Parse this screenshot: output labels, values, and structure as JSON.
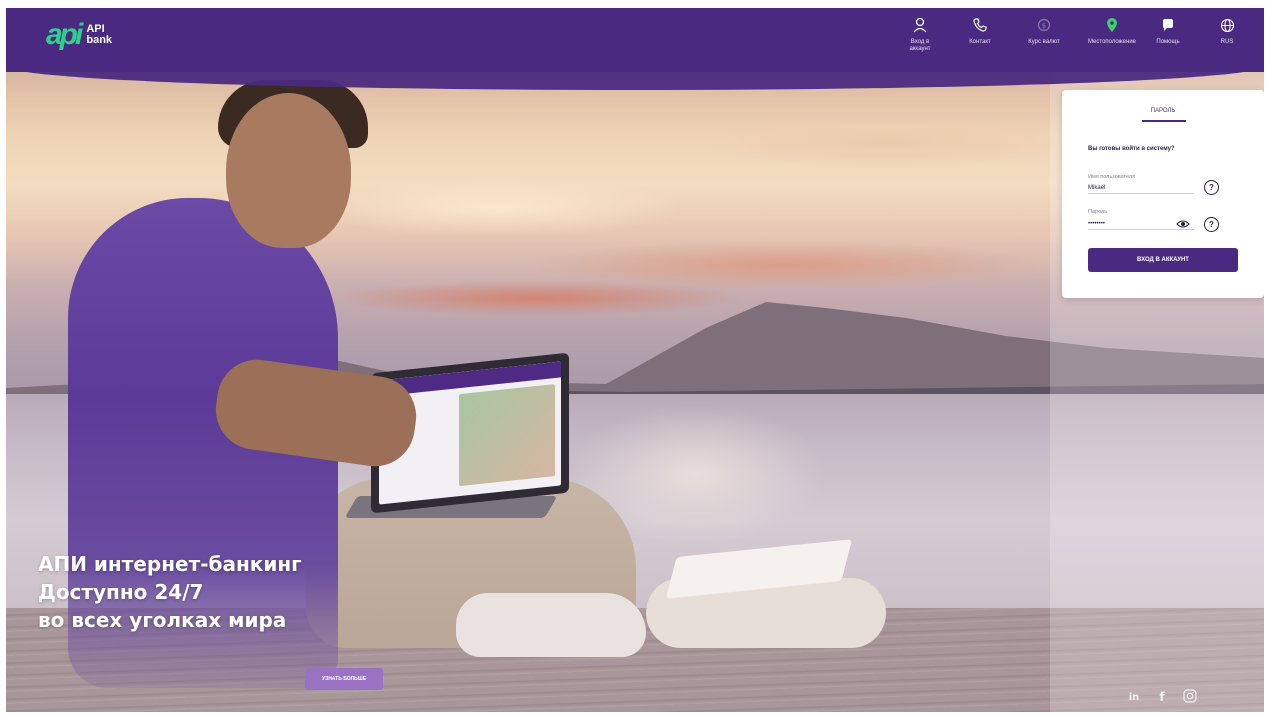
{
  "header": {
    "logo_mark": "api",
    "logo_text_line1": "API",
    "logo_text_line2": "bank",
    "nav": [
      {
        "label": "Вход в аккаунт",
        "icon": "user-icon"
      },
      {
        "label": "Контакт",
        "icon": "phone-icon"
      },
      {
        "label": "Курс валют",
        "icon": "currency-icon"
      },
      {
        "label": "Местоположение",
        "icon": "location-pin-icon"
      },
      {
        "label": "Помощь",
        "icon": "chat-icon"
      },
      {
        "label": "RUS",
        "icon": "globe-icon"
      }
    ]
  },
  "login": {
    "tab_label": "ПАРОЛЬ",
    "question": "Вы готовы войти в систему?",
    "username_label": "Имя пользователя",
    "username_value": "Mikael",
    "password_label": "Пароль",
    "password_value": "••••••••",
    "help_symbol": "?",
    "submit_label": "ВХОД В АККАУНТ"
  },
  "hero": {
    "line1": "АПИ интернет-банкинг",
    "line2": "Доступно 24/7",
    "line3": "во всех уголках мира",
    "more_button": "УЗНАТЬ БОЛЬШЕ"
  },
  "social": [
    {
      "icon": "linkedin-icon",
      "glyph": "in"
    },
    {
      "icon": "facebook-icon",
      "glyph": "f"
    },
    {
      "icon": "instagram-icon",
      "glyph": ""
    }
  ],
  "colors": {
    "brand_purple": "#4a2a80",
    "logo_green": "#2fd08a",
    "location_green": "#3bd06e",
    "more_button": "#9a72c4"
  }
}
